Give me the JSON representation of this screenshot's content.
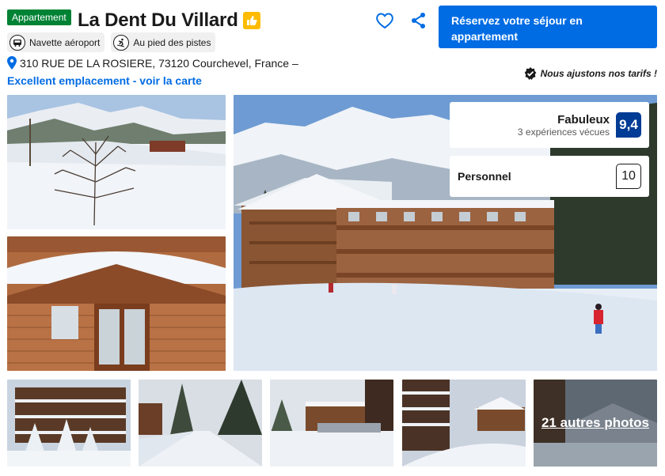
{
  "header": {
    "type_badge": "Appartement",
    "title": "La Dent Du Villard",
    "features": [
      {
        "label": "Navette aéroport",
        "icon": "shuttle-icon"
      },
      {
        "label": "Au pied des pistes",
        "icon": "skier-icon"
      }
    ],
    "address": "310 RUE DE LA ROSIERE, 73120 Courchevel, France –",
    "map_link": "Excellent emplacement - voir la carte",
    "cta": "Réservez votre séjour en appartement",
    "price_promise": "Nous ajustons nos tarifs !"
  },
  "rating": {
    "label": "Fabuleux",
    "reviews": "3 expériences vécues",
    "score": "9,4"
  },
  "staff": {
    "label": "Personnel",
    "score": "10"
  },
  "gallery": {
    "more_label": "21 autres photos"
  },
  "colors": {
    "brand_blue": "#006ce4",
    "score_navy": "#003b95",
    "badge_green": "#008234",
    "genius_yellow": "#febb02"
  }
}
